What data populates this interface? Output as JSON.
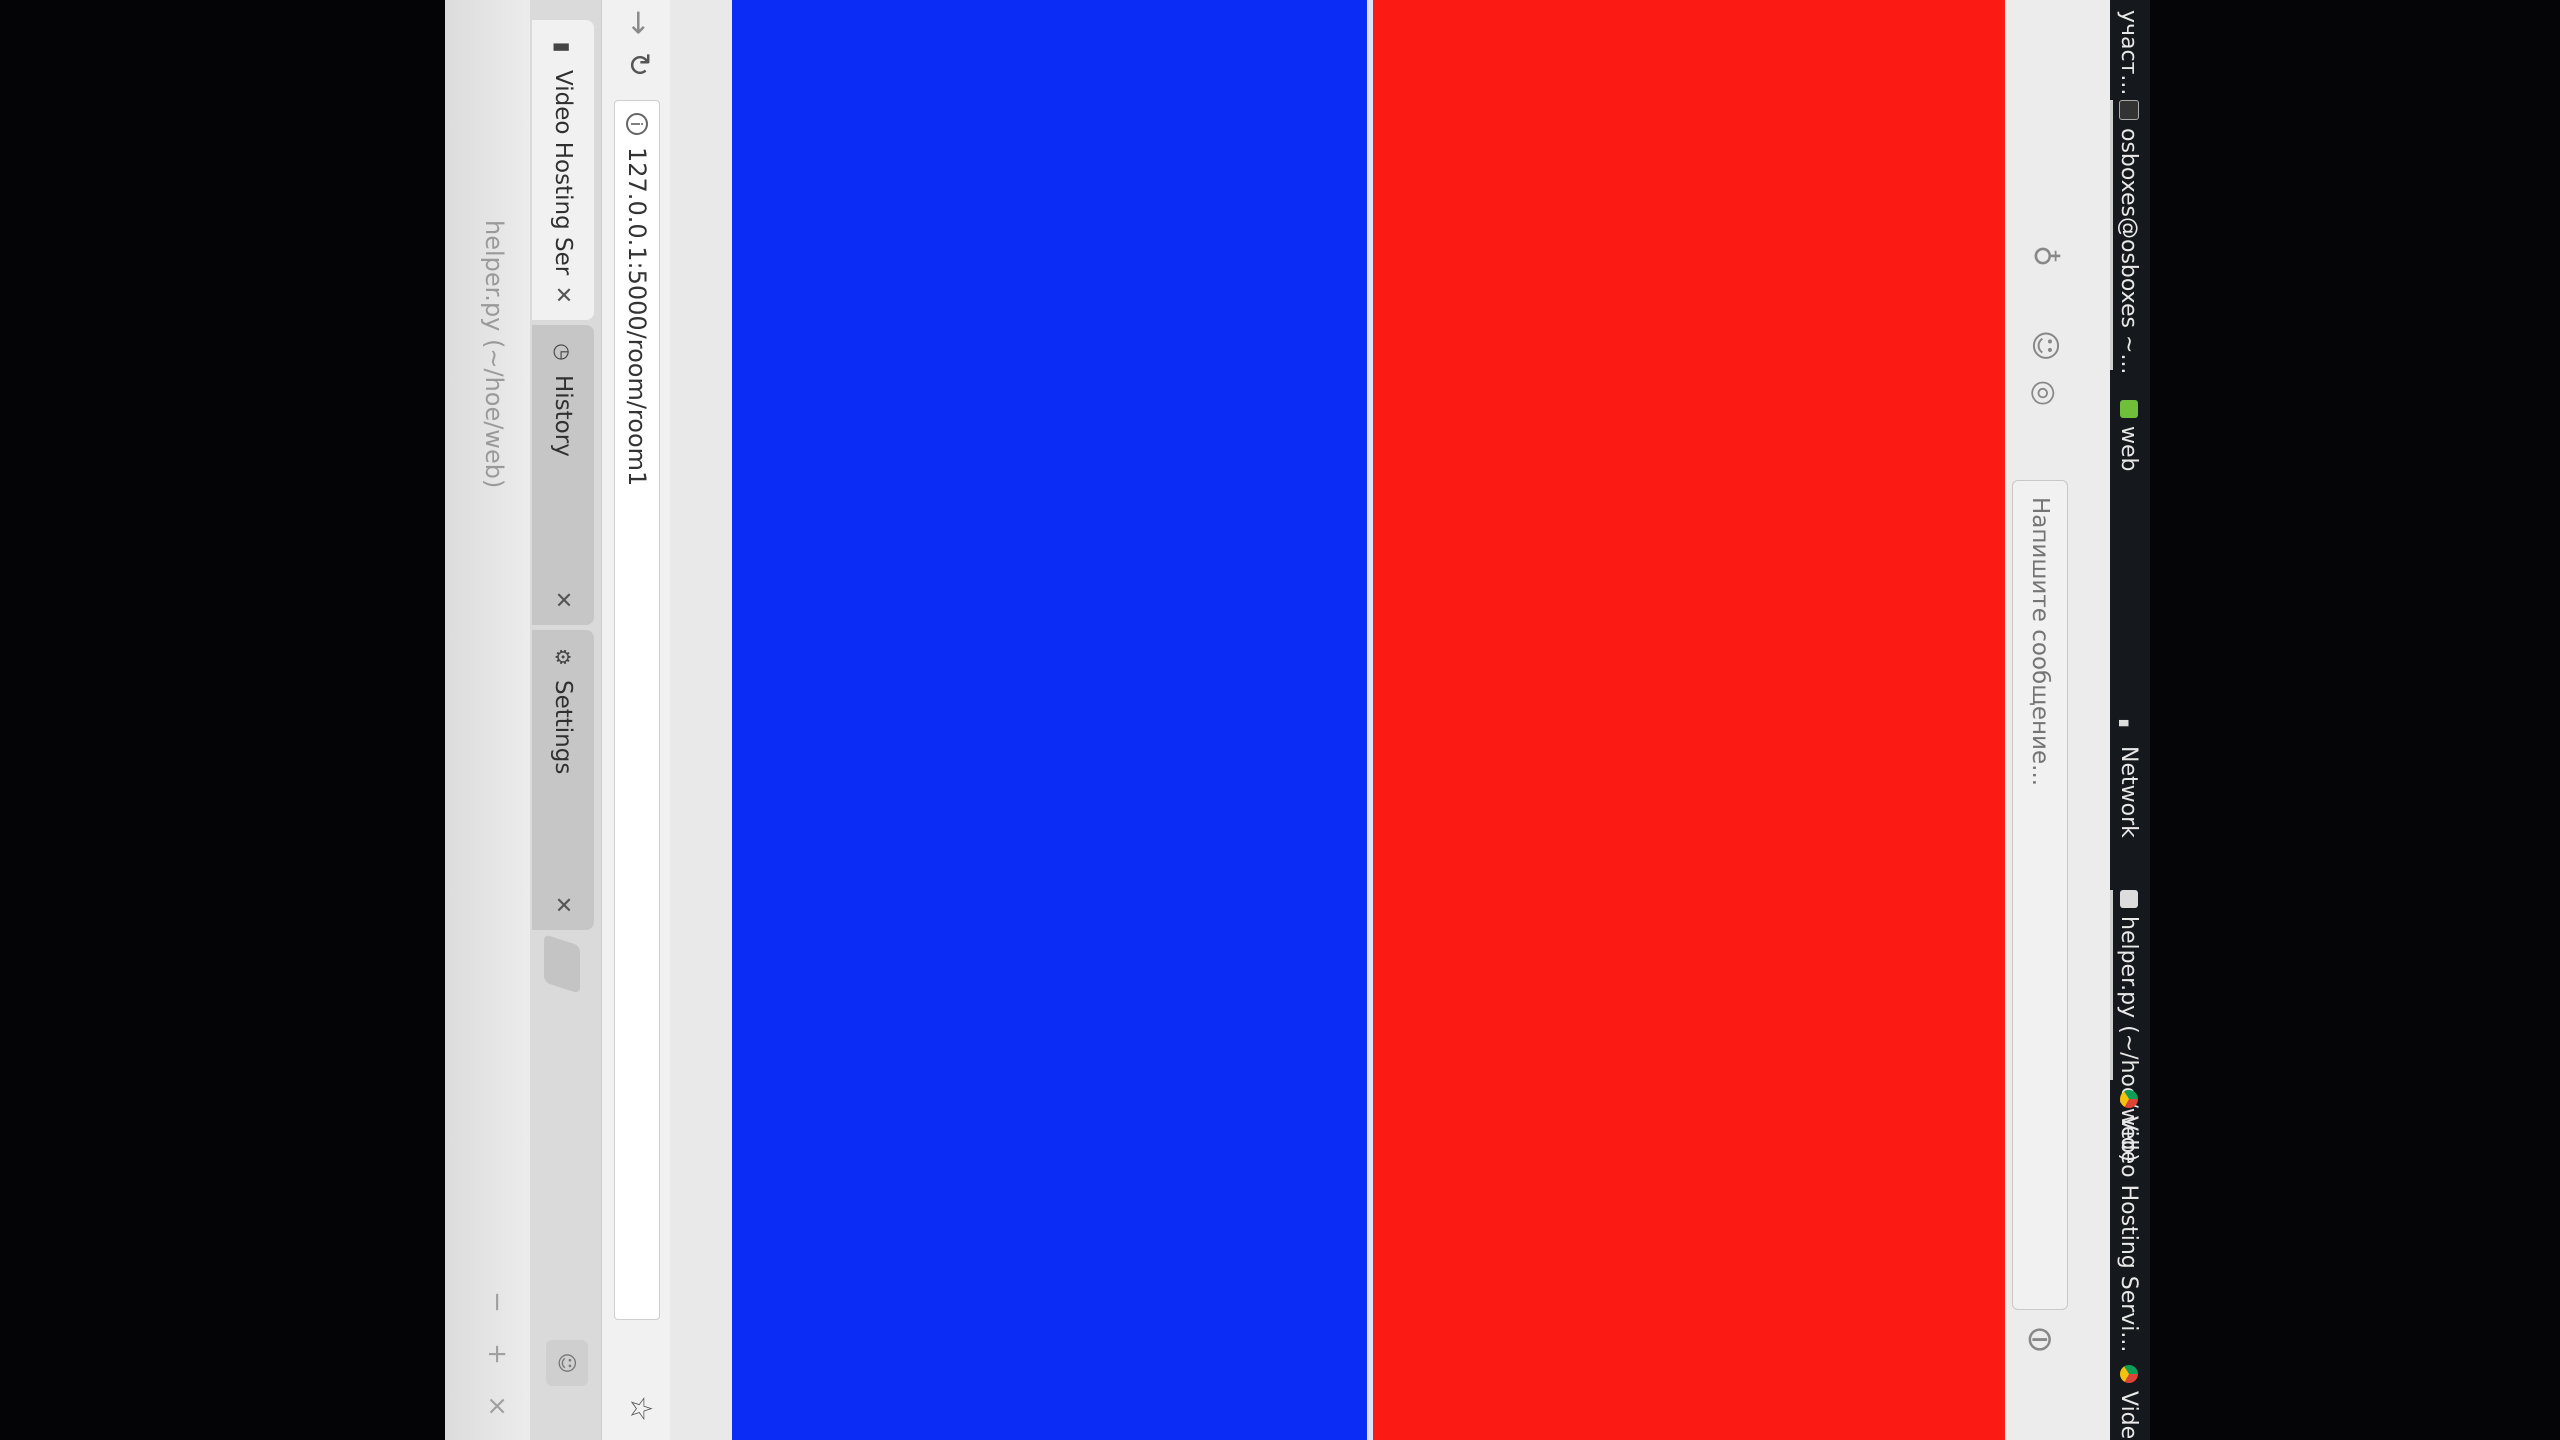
{
  "window": {
    "title": "helper.py (~/hoe/web)",
    "controls": [
      "−",
      "+",
      "×"
    ]
  },
  "tabs": [
    {
      "label": "Video Hosting Service",
      "icon": "film-icon",
      "active": true
    },
    {
      "label": "History",
      "icon": "history-icon",
      "active": false
    },
    {
      "label": "Settings",
      "icon": "gear-icon",
      "active": false
    }
  ],
  "toolbar": {
    "url": "127.0.0.1:5000/room/room1"
  },
  "video": {
    "left_color": "#0a2cf4",
    "right_color": "#fb1a14"
  },
  "chat": {
    "placeholder": "Напишите сообщение..."
  },
  "taskbar": {
    "items": [
      "участ...",
      "osboxes@osboxes ~...",
      "web",
      "Network",
      "helper.py (~/hoe/web)",
      "Video Hosting Servi...",
      "Video H"
    ]
  }
}
